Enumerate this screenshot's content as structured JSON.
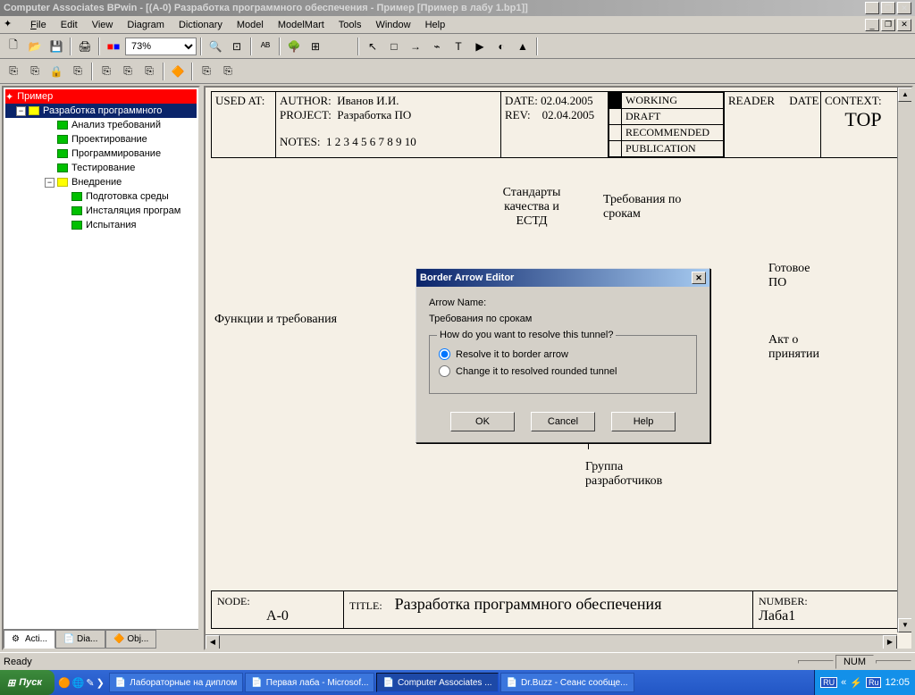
{
  "window": {
    "title": "Computer Associates BPwin - [(A-0) Разработка программного обеспечения - Пример  [Пример в лабу 1.bp1]]"
  },
  "menu": [
    "File",
    "Edit",
    "View",
    "Diagram",
    "Dictionary",
    "Model",
    "ModelMart",
    "Tools",
    "Window",
    "Help"
  ],
  "zoom": "73%",
  "tree": {
    "root": "Пример",
    "selected": "Разработка программного",
    "items": [
      {
        "level": 2,
        "icon": "green",
        "label": "Анализ требований"
      },
      {
        "level": 2,
        "icon": "green",
        "label": "Проектирование"
      },
      {
        "level": 2,
        "icon": "green",
        "label": "Программирование"
      },
      {
        "level": 2,
        "icon": "green",
        "label": "Тестирование"
      },
      {
        "level": 2,
        "icon": "yellow",
        "label": "Внедрение",
        "expanded": true
      },
      {
        "level": 3,
        "icon": "green",
        "label": "Подготовка среды"
      },
      {
        "level": 3,
        "icon": "green",
        "label": "Инсталяция програм"
      },
      {
        "level": 3,
        "icon": "green",
        "label": "Испытания"
      }
    ]
  },
  "tabs": {
    "active": "Acti...",
    "items": [
      "Acti...",
      "Dia...",
      "Obj..."
    ]
  },
  "idef": {
    "used_at": "USED AT:",
    "author_label": "AUTHOR:",
    "author": "Иванов И.И.",
    "project_label": "PROJECT:",
    "project": "Разработка ПО",
    "date_label": "DATE:",
    "date": "02.04.2005",
    "rev_label": "REV:",
    "rev": "02.04.2005",
    "notes_label": "NOTES:",
    "notes": "1  2  3  4  5  6  7  8  9  10",
    "statuses": [
      "WORKING",
      "DRAFT",
      "RECOMMENDED",
      "PUBLICATION"
    ],
    "reader": "READER",
    "date2": "DATE",
    "context_label": "CONTEXT:",
    "context": "TOP",
    "node_label": "NODE:",
    "node": "A-0",
    "title_label": "TITLE:",
    "title": "Разработка программного обеспечения",
    "number_label": "NUMBER:",
    "number": "Лаба1"
  },
  "labels": {
    "standards": "Стандарты качества и ЕСТД",
    "requirements_time": "Требования по срокам",
    "functions": "Функции и требования",
    "ready_sw": "Готовое ПО",
    "act": "Акт о принятии",
    "dev_group": "Группа разработчиков"
  },
  "dialog": {
    "title": "Border Arrow Editor",
    "arrow_name_label": "Arrow Name:",
    "arrow_name": "Требования по срокам",
    "question": "How do you want to resolve this tunnel?",
    "opt1": "Resolve it to border arrow",
    "opt2": "Change it to resolved rounded tunnel",
    "ok": "OK",
    "cancel": "Cancel",
    "help": "Help"
  },
  "status": {
    "ready": "Ready",
    "num": "NUM"
  },
  "taskbar": {
    "start": "Пуск",
    "items": [
      {
        "label": "Лабораторные на диплом",
        "active": false
      },
      {
        "label": "Первая лаба - Microsof...",
        "active": false
      },
      {
        "label": "Computer Associates ...",
        "active": true
      },
      {
        "label": "Dr.Buzz - Сеанс сообще...",
        "active": false
      }
    ],
    "lang1": "RU",
    "lang2": "Ru",
    "clock": "12:05"
  }
}
